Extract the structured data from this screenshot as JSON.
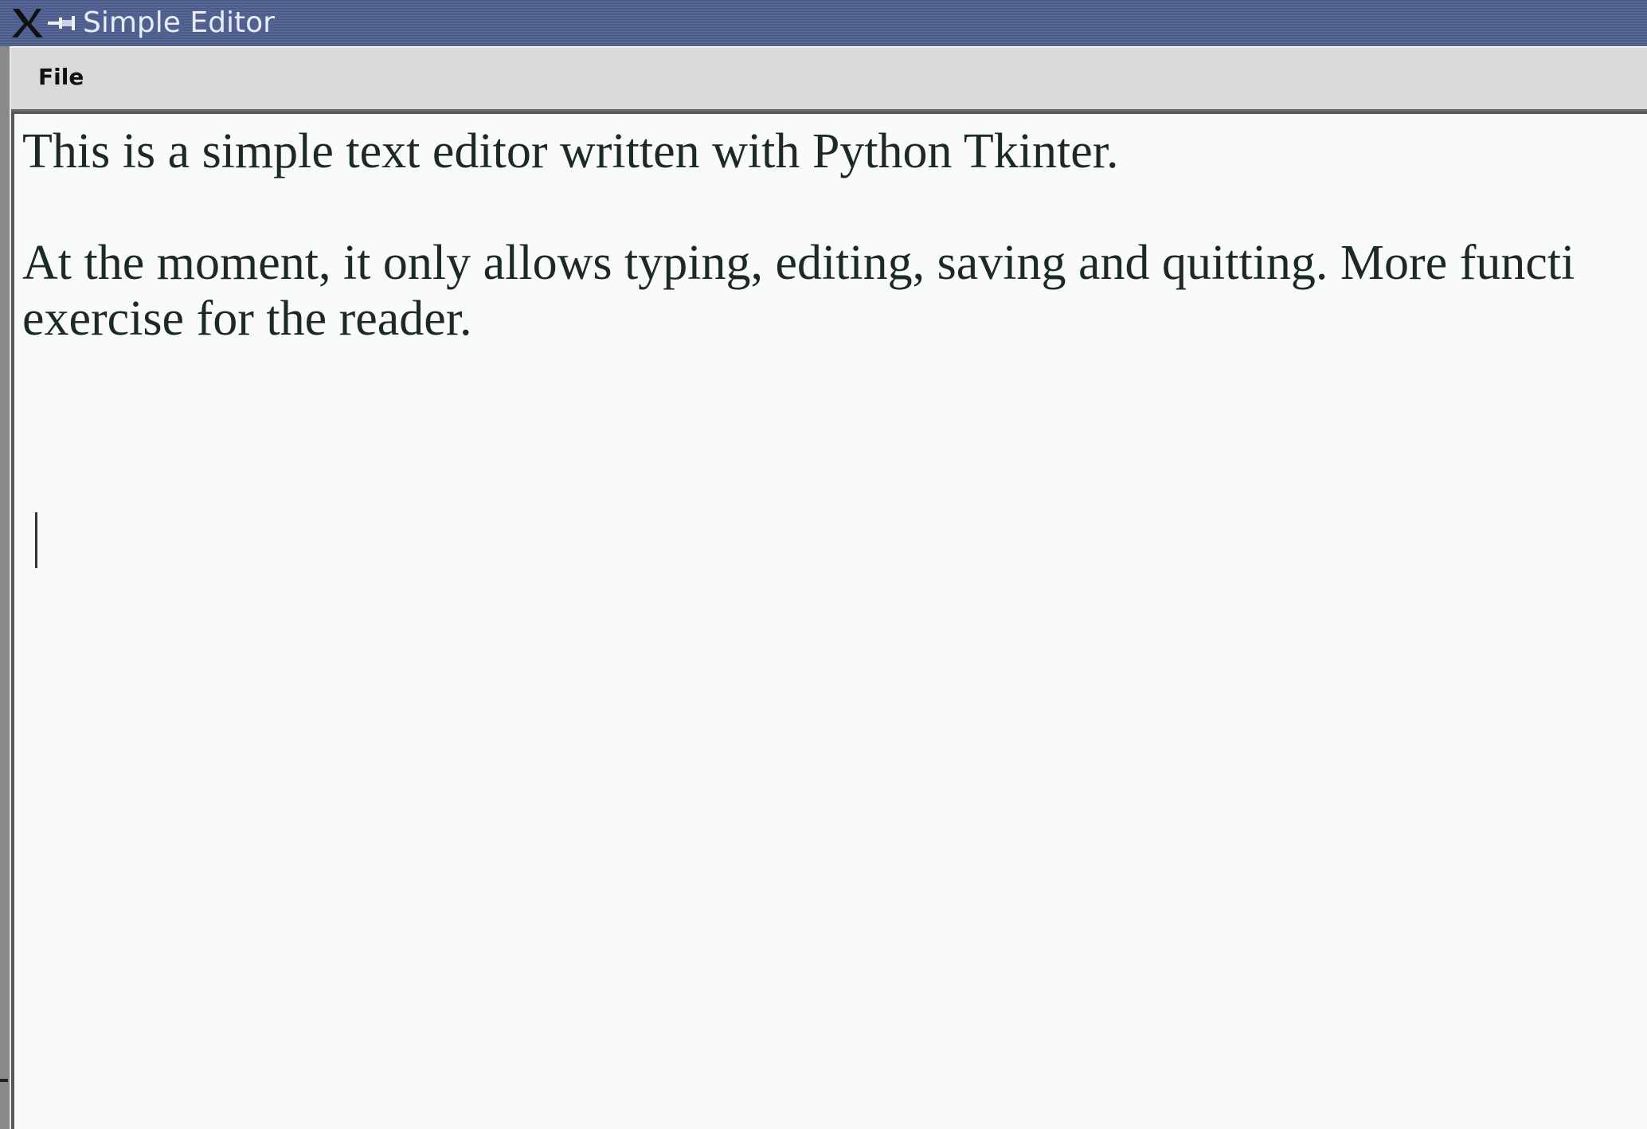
{
  "window": {
    "title": "Simple Editor"
  },
  "menubar": {
    "items": [
      {
        "label": "File"
      }
    ]
  },
  "editor": {
    "lines": [
      "This is a simple text editor written with Python Tkinter.",
      "",
      "At the moment, it only allows typing, editing, saving and quitting. More functi",
      "exercise for the reader."
    ]
  },
  "icons": {
    "window_menu": "x-icon",
    "pin": "pin-icon"
  },
  "colors": {
    "titlebar": "#4d5f8f",
    "menubar": "#d8dad8",
    "editor_bg": "#f8fbf8",
    "text": "#1b2a26"
  }
}
